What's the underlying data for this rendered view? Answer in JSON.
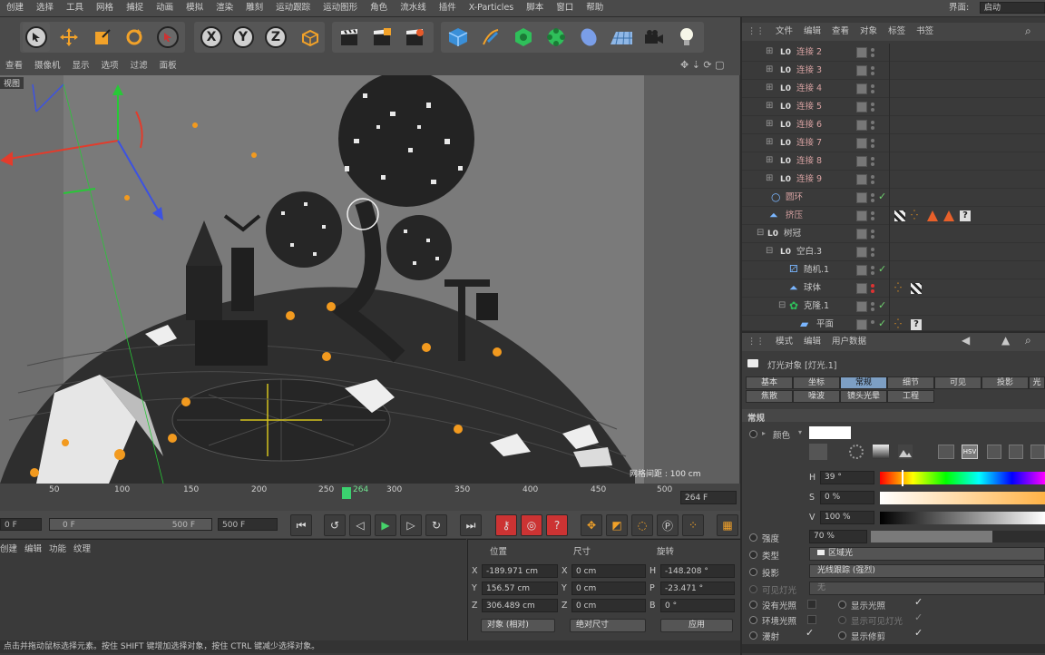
{
  "menubar": {
    "items": [
      "创建",
      "选择",
      "工具",
      "网格",
      "捕捉",
      "动画",
      "模拟",
      "渲染",
      "雕刻",
      "运动跟踪",
      "运动图形",
      "角色",
      "流水线",
      "插件",
      "X-Particles",
      "脚本",
      "窗口",
      "帮助"
    ],
    "layout_label": "界面:",
    "layout_value": "启动"
  },
  "viewport_menu": [
    "查看",
    "摄像机",
    "显示",
    "选项",
    "过滤",
    "面板"
  ],
  "viewport": {
    "label": "视图",
    "grid_distance": "网格间距 : 100 cm"
  },
  "timeline": {
    "ticks": [
      "50",
      "100",
      "150",
      "200",
      "250",
      "264",
      "300",
      "350",
      "400",
      "450",
      "500"
    ],
    "current_frame": "264 F"
  },
  "transport": {
    "start_field": "0 F",
    "range_start": "0 F",
    "range_end": "500 F",
    "end_field": "500 F"
  },
  "material_menu": [
    "创建",
    "编辑",
    "功能",
    "纹理"
  ],
  "coordinates": {
    "headers": {
      "position": "位置",
      "size": "尺寸",
      "rotation": "旋转"
    },
    "rows": [
      {
        "axis": "X",
        "pos": "-189.971 cm",
        "size_axis": "X",
        "size": "0 cm",
        "rot_axis": "H",
        "rot": "-148.208 °"
      },
      {
        "axis": "Y",
        "pos": "156.57 cm",
        "size_axis": "Y",
        "size": "0 cm",
        "rot_axis": "P",
        "rot": "-23.471 °"
      },
      {
        "axis": "Z",
        "pos": "306.489 cm",
        "size_axis": "Z",
        "size": "0 cm",
        "rot_axis": "B",
        "rot": "0 °"
      }
    ],
    "mode_select": "对象 (相对)",
    "size_select": "绝对尺寸",
    "apply_button": "应用"
  },
  "status_text": "点击并拖动鼠标选择元素。按住 SHIFT 键增加选择对象，按住 CTRL 键减少选择对象。",
  "object_manager": {
    "menu": [
      "文件",
      "编辑",
      "查看",
      "对象",
      "标签",
      "书签"
    ],
    "rows": [
      {
        "name": "连接 2",
        "icon": "null-icon"
      },
      {
        "name": "连接 3",
        "icon": "null-icon"
      },
      {
        "name": "连接 4",
        "icon": "null-icon"
      },
      {
        "name": "连接 5",
        "icon": "null-icon"
      },
      {
        "name": "连接 6",
        "icon": "null-icon"
      },
      {
        "name": "连接 7",
        "icon": "null-icon"
      },
      {
        "name": "连接 8",
        "icon": "null-icon"
      },
      {
        "name": "连接 9",
        "icon": "null-icon"
      },
      {
        "name": "圆环",
        "icon": "circle-spline-icon"
      },
      {
        "name": "挤压",
        "icon": "extrude-icon"
      },
      {
        "name": "树冠",
        "icon": "null-icon"
      },
      {
        "name": "空白.3",
        "icon": "null-icon"
      },
      {
        "name": "随机.1",
        "icon": "random-effector-icon"
      },
      {
        "name": "球体",
        "icon": "sphere-icon"
      },
      {
        "name": "克隆.1",
        "icon": "cloner-icon"
      },
      {
        "name": "平面",
        "icon": "plane-icon"
      }
    ]
  },
  "attributes": {
    "menu": [
      "模式",
      "编辑",
      "用户数据"
    ],
    "object_title": "灯光对象 [灯光.1]",
    "tabs_row1": [
      "基本",
      "坐标",
      "常规",
      "细节",
      "可见",
      "投影",
      "光度"
    ],
    "tabs_row2": [
      "焦散",
      "噪波",
      "镜头光晕",
      "工程"
    ],
    "section": "常规",
    "color_label": "颜色",
    "h_label": "H",
    "h_value": "39 °",
    "s_label": "S",
    "s_value": "0 %",
    "v_label": "V",
    "v_value": "100 %",
    "intensity_label": "强度",
    "intensity_value": "70 %",
    "intensity_fraction": 0.7,
    "type_label": "类型",
    "type_value": "区域光",
    "shadow_label": "投影",
    "shadow_value": "光线跟踪 (强烈)",
    "visible_light_label": "可见灯光",
    "visible_light_value": "无",
    "no_illum_label": "没有光照",
    "show_light_label": "显示光照",
    "ambient_label": "环境光照",
    "show_visible_label": "显示可见灯光",
    "diffuse_label": "漫射",
    "show_clipping_label": "显示修剪"
  },
  "colors": {
    "accent_tab": "#7d9fc4",
    "playhead": "#3bd16f",
    "hue": "#ffb347"
  }
}
